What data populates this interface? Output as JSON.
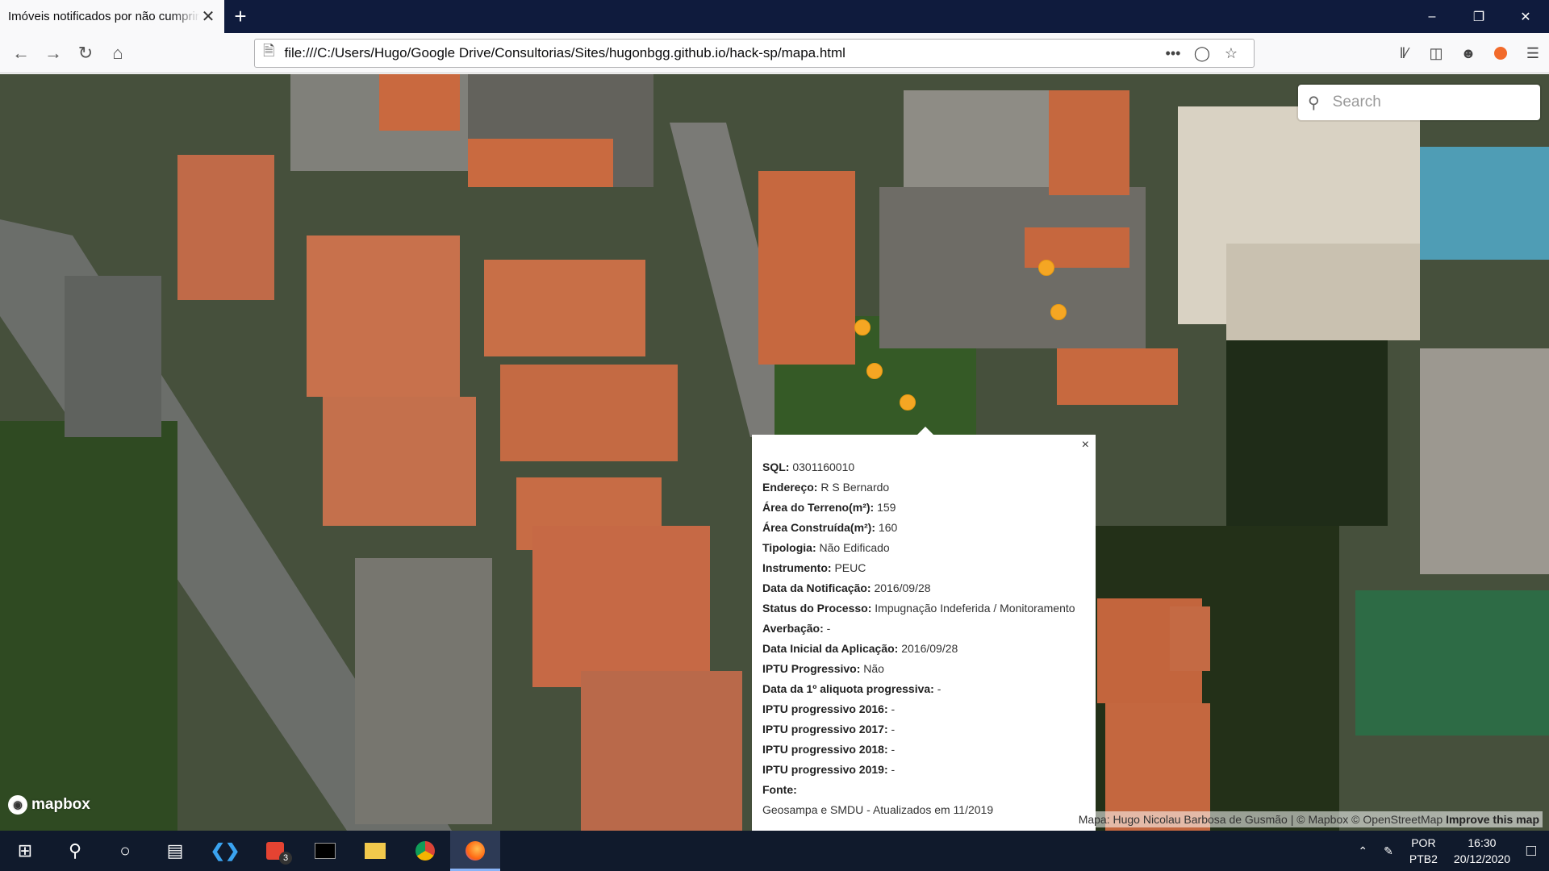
{
  "browser": {
    "tab_title": "Imóveis notificados por não cumprir",
    "tab_close": "✕",
    "new_tab": "+",
    "url": "file:///C:/Users/Hugo/Google Drive/Consultorias/Sites/hugonbgg.github.io/hack-sp/mapa.html",
    "page_actions": "•••"
  },
  "map": {
    "search_placeholder": "Search",
    "logo_text": "mapbox",
    "attribution_text": "Mapa: Hugo Nicolau Barbosa de Gusmão | © Mapbox © OpenStreetMap",
    "attribution_improve": "Improve this map",
    "marker_color": "#f5a623"
  },
  "popup": {
    "close": "×",
    "rows": [
      {
        "label": "SQL:",
        "value": "0301160010"
      },
      {
        "label": "Endereço:",
        "value": "R S Bernardo"
      },
      {
        "label": "Área do Terreno(m²):",
        "value": "159"
      },
      {
        "label": "Área Construída(m²):",
        "value": "160"
      },
      {
        "label": "Tipologia:",
        "value": "Não Edificado"
      },
      {
        "label": "Instrumento:",
        "value": "PEUC"
      },
      {
        "label": "Data da Notificação:",
        "value": "2016/09/28"
      },
      {
        "label": "Status do Processo:",
        "value": "Impugnação Indeferida / Monitoramento"
      },
      {
        "label": "Averbação:",
        "value": "-"
      },
      {
        "label": "Data Inicial da Aplicação:",
        "value": "2016/09/28"
      },
      {
        "label": "IPTU Progressivo:",
        "value": "Não"
      },
      {
        "label": "Data da 1º aliquota progressiva:",
        "value": "-"
      },
      {
        "label": "IPTU progressivo 2016:",
        "value": "-"
      },
      {
        "label": "IPTU progressivo 2017:",
        "value": "-"
      },
      {
        "label": "IPTU progressivo 2018:",
        "value": "-"
      },
      {
        "label": "IPTU progressivo 2019:",
        "value": "-"
      },
      {
        "label": "Fonte:",
        "value": ""
      }
    ],
    "source_text": "Geosampa e SMDU - Atualizados em 11/2019"
  },
  "taskbar": {
    "badge_count": "3",
    "lang_top": "POR",
    "lang_bottom": "PTB2",
    "time": "16:30",
    "date": "20/12/2020"
  }
}
